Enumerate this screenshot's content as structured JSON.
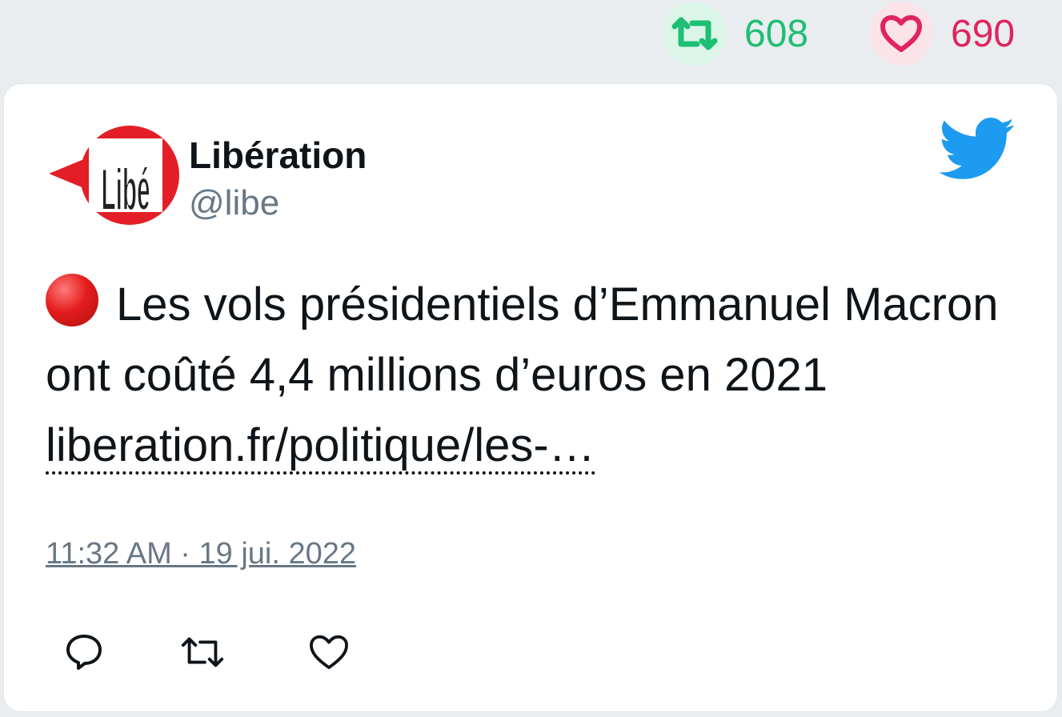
{
  "stats": {
    "retweets": "608",
    "likes": "690"
  },
  "tweet": {
    "author_name": "Libération",
    "author_handle": "@libe",
    "avatar_logo_text": "Libé",
    "text": "Les vols présidentiels d’Emmanuel Macron ont coûté 4,4 millions d’euros en 2021",
    "link": "liberation.fr/politique/les-…",
    "timestamp": "11:32 AM · 19 jui. 2022"
  },
  "icons": {
    "top_retweet": "retweet-icon",
    "top_like": "heart-icon",
    "brand": "twitter-bird-icon",
    "emoji": "red-circle-icon",
    "reply": "reply-icon",
    "retweet": "retweet-icon",
    "like": "heart-icon"
  },
  "colors": {
    "retweet_green": "#1dbf73",
    "like_red": "#e0245e",
    "twitter_blue": "#1d9bf0",
    "muted_text": "#687785"
  }
}
